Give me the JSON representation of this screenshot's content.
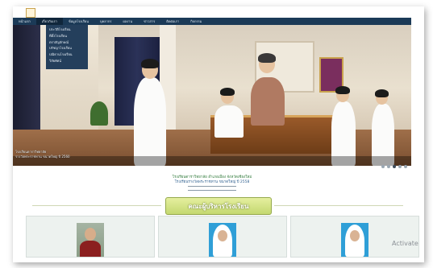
{
  "nav": {
    "items": [
      "หน้าแรก",
      "เกี่ยวกับเรา",
      "ข้อมูลโรงเรียน",
      "บุคลากร",
      "ผลงาน",
      "ข่าวสาร",
      "ติดต่อเรา",
      "กิจกรรม"
    ]
  },
  "dropdown": {
    "items": [
      "ประวัติโรงเรียน",
      "ที่ตั้งโรงเรียน",
      "ตราสัญลักษณ์",
      "ปรัชญาโรงเรียน",
      "ปณิธานโรงเรียน",
      "วิสัยทัศน์"
    ]
  },
  "hero": {
    "caption_line1": "โรงเรียนดาราวิทยาลัย",
    "caption_line2": "รางวัลพระราชทาน ขนาดใหญ่ ปี 2560"
  },
  "school": {
    "line1": "โรงเรียนดาราวิทยาลัย อำเภอเมือง จังหวัดเชียงใหม่",
    "line2": "โรงเรียนรางวัลพระราชทาน ขนาดใหญ่ ปี 2558"
  },
  "section": {
    "title": "คณะผู้บริหารโรงเรียน"
  },
  "watermark": {
    "text": "Activate"
  }
}
